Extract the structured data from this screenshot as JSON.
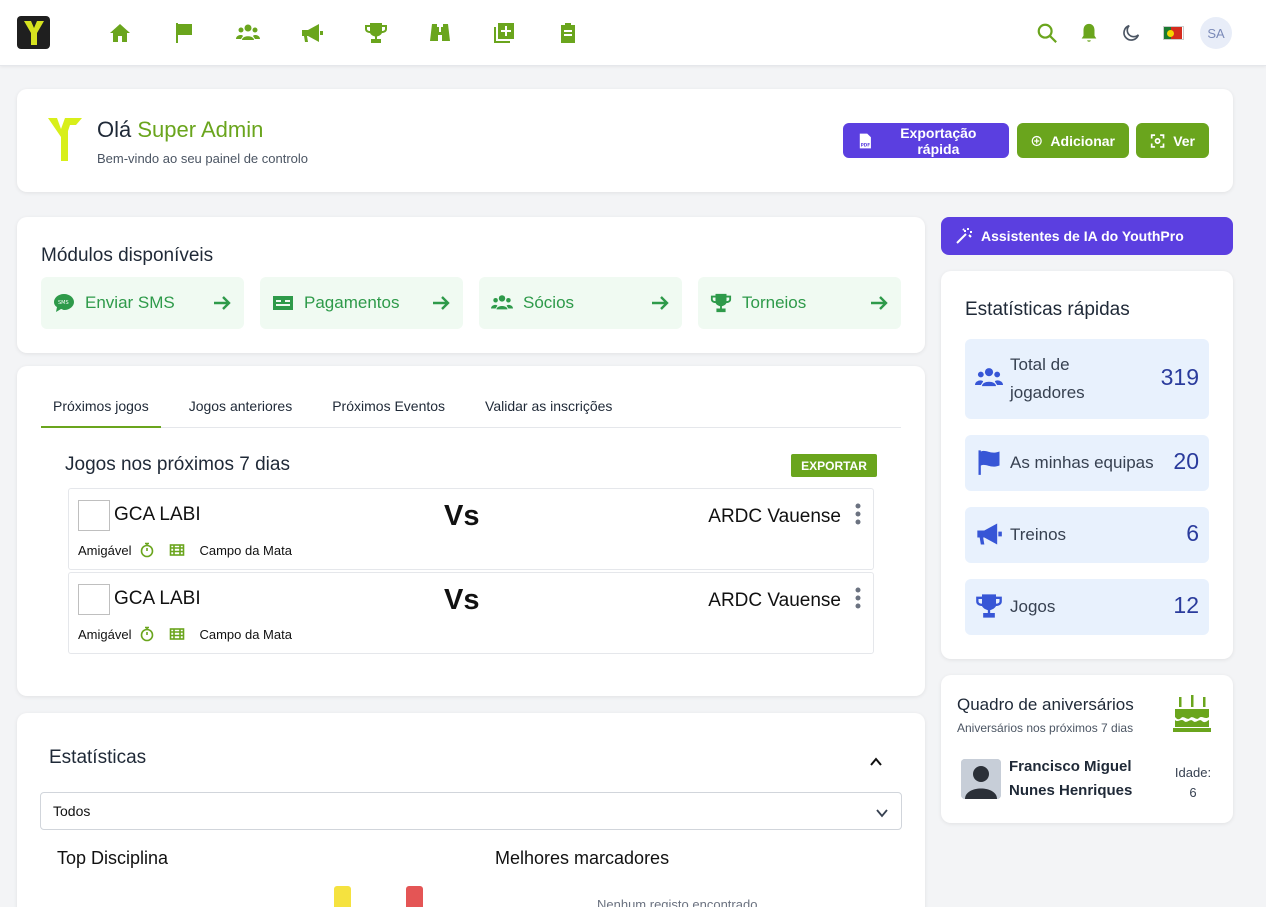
{
  "nav": {
    "icons": [
      "home-icon",
      "flag-icon",
      "users-icon",
      "megaphone-icon",
      "trophy-icon",
      "binoculars-icon",
      "add-square-icon",
      "clipboard-icon"
    ],
    "avatar_initials": "SA",
    "accent_color": "#6aa51d",
    "purple_color": "#5b3fe0"
  },
  "welcome": {
    "greeting": "Olá",
    "name": "Super Admin",
    "subtitle": "Bem-vindo ao seu painel de controlo",
    "buttons": {
      "export": "Exportação rápida",
      "add": "Adicionar",
      "view": "Ver"
    }
  },
  "modules": {
    "title": "Módulos disponíveis",
    "items": [
      {
        "label": "Enviar SMS",
        "icon": "sms-icon"
      },
      {
        "label": "Pagamentos",
        "icon": "money-icon"
      },
      {
        "label": "Sócios",
        "icon": "users-icon"
      },
      {
        "label": "Torneios",
        "icon": "trophy-icon"
      }
    ]
  },
  "games": {
    "tabs": [
      "Próximos jogos",
      "Jogos anteriores",
      "Próximos Eventos",
      "Validar as inscrições"
    ],
    "section_title": "Jogos nos próximos 7 dias",
    "export_label": "EXPORTAR",
    "matches": [
      {
        "home": "GCA LABI",
        "vs": "Vs",
        "away": "ARDC Vauense",
        "type": "Amigável",
        "venue": "Campo da Mata"
      },
      {
        "home": "GCA LABI",
        "vs": "Vs",
        "away": "ARDC Vauense",
        "type": "Amigável",
        "venue": "Campo da Mata"
      }
    ]
  },
  "stats": {
    "title": "Estatísticas",
    "filter_value": "Todos",
    "discipline_title": "Top Disciplina",
    "scorers_title": "Melhores marcadores",
    "no_data": "Nenhum registo encontrado"
  },
  "ai": {
    "label": "Assistentes de IA do YouthPro"
  },
  "quick_stats": {
    "title": "Estatísticas rápidas",
    "items": [
      {
        "label": "Total de jogadores",
        "value": "319",
        "icon": "users-icon"
      },
      {
        "label": "As minhas equipas",
        "value": "20",
        "icon": "flag-icon"
      },
      {
        "label": "Treinos",
        "value": "6",
        "icon": "megaphone-icon"
      },
      {
        "label": "Jogos",
        "value": "12",
        "icon": "trophy-icon"
      }
    ]
  },
  "birthdays": {
    "title": "Quadro de aniversários",
    "subtitle": "Aniversários nos próximos 7 dias",
    "person": "Francisco Miguel Nunes Henriques",
    "age_label": "Idade:",
    "age_value": "6"
  }
}
